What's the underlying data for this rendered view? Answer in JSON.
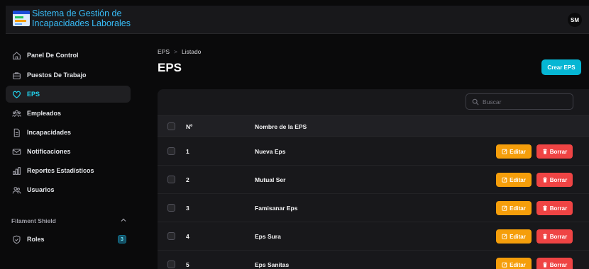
{
  "app": {
    "title_line1": "Sistema de Gestión de",
    "title_line2": "Incapacidades Laborales",
    "user_initials": "SM"
  },
  "sidebar": {
    "items": [
      {
        "label": "Panel De Control",
        "icon": "home-icon"
      },
      {
        "label": "Puestos De Trabajo",
        "icon": "briefcase-icon"
      },
      {
        "label": "EPS",
        "icon": "heart-icon",
        "active": true
      },
      {
        "label": "Empleados",
        "icon": "users-icon"
      },
      {
        "label": "Incapacidades",
        "icon": "document-icon"
      },
      {
        "label": "Notificaciones",
        "icon": "mail-icon"
      },
      {
        "label": "Reportes Estadísticos",
        "icon": "chart-bar-icon"
      },
      {
        "label": "Usuarios",
        "icon": "user-group-icon"
      }
    ],
    "group": {
      "label": "Filament Shield",
      "items": [
        {
          "label": "Roles",
          "icon": "shield-check-icon",
          "badge": "3"
        }
      ]
    }
  },
  "breadcrumb": {
    "item1": "EPS",
    "sep": ">",
    "item2": "Listado"
  },
  "page": {
    "title": "EPS",
    "create_label": "Crear EPS"
  },
  "search": {
    "placeholder": "Buscar"
  },
  "table": {
    "columns": [
      "Nº",
      "Nombre de la EPS"
    ],
    "rows": [
      {
        "num": "1",
        "name": "Nueva Eps"
      },
      {
        "num": "2",
        "name": "Mutual Ser"
      },
      {
        "num": "3",
        "name": "Famisanar Eps"
      },
      {
        "num": "4",
        "name": "Eps Sura"
      },
      {
        "num": "5",
        "name": "Eps Sanitas"
      }
    ],
    "edit_label": "Editar",
    "delete_label": "Borrar"
  },
  "colors": {
    "accent": "#06b6d4",
    "edit": "#f59e0b",
    "delete": "#ef4444",
    "background": "#0a0a0b",
    "panel": "#18181b"
  }
}
